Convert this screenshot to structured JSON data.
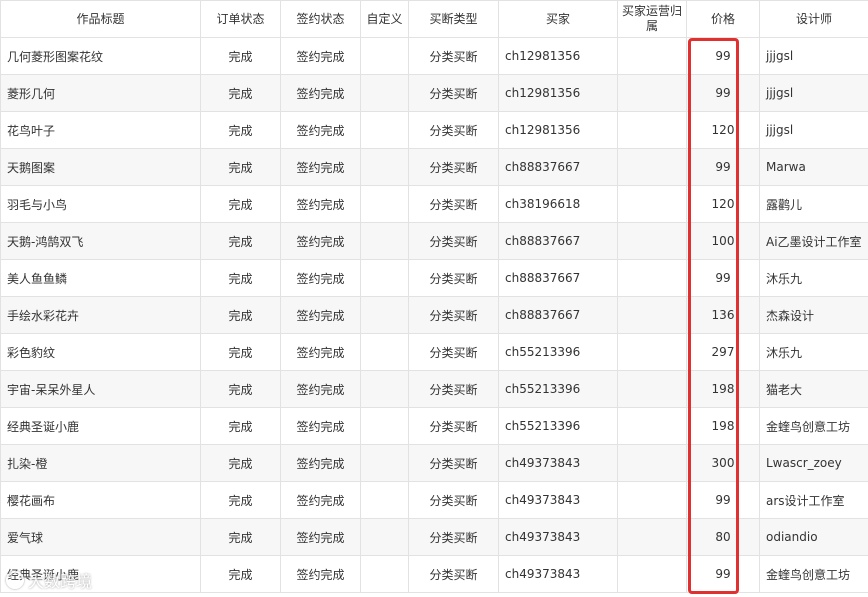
{
  "table": {
    "headers": [
      "作品标题",
      "订单状态",
      "签约状态",
      "自定义",
      "买断类型",
      "买家",
      "买家运营归属",
      "价格",
      "设计师"
    ],
    "rows": [
      [
        "几何菱形图案花纹",
        "完成",
        "签约完成",
        "",
        "分类买断",
        "ch12981356",
        "",
        "99",
        "jjjgsl"
      ],
      [
        "菱形几何",
        "完成",
        "签约完成",
        "",
        "分类买断",
        "ch12981356",
        "",
        "99",
        "jjjgsl"
      ],
      [
        "花鸟叶子",
        "完成",
        "签约完成",
        "",
        "分类买断",
        "ch12981356",
        "",
        "120",
        "jjjgsl"
      ],
      [
        "天鹅图案",
        "完成",
        "签约完成",
        "",
        "分类买断",
        "ch88837667",
        "",
        "99",
        "Marwa"
      ],
      [
        "羽毛与小鸟",
        "完成",
        "签约完成",
        "",
        "分类买断",
        "ch38196618",
        "",
        "120",
        "露鹳儿"
      ],
      [
        "天鹅-鸿鹄双飞",
        "完成",
        "签约完成",
        "",
        "分类买断",
        "ch88837667",
        "",
        "100",
        "Ai乙墨设计工作室"
      ],
      [
        "美人鱼鱼鳞",
        "完成",
        "签约完成",
        "",
        "分类买断",
        "ch88837667",
        "",
        "99",
        "沐乐九"
      ],
      [
        "手绘水彩花卉",
        "完成",
        "签约完成",
        "",
        "分类买断",
        "ch88837667",
        "",
        "136",
        "杰森设计"
      ],
      [
        "彩色豹纹",
        "完成",
        "签约完成",
        "",
        "分类买断",
        "ch55213396",
        "",
        "297",
        "沐乐九"
      ],
      [
        "宇宙-呆呆外星人",
        "完成",
        "签约完成",
        "",
        "分类买断",
        "ch55213396",
        "",
        "198",
        "猫老大"
      ],
      [
        "经典圣诞小鹿",
        "完成",
        "签约完成",
        "",
        "分类买断",
        "ch55213396",
        "",
        "198",
        "金蝰鸟创意工坊"
      ],
      [
        "扎染-橙",
        "完成",
        "签约完成",
        "",
        "分类买断",
        "ch49373843",
        "",
        "300",
        "Lwascr_zoey"
      ],
      [
        "樱花画布",
        "完成",
        "签约完成",
        "",
        "分类买断",
        "ch49373843",
        "",
        "99",
        "ars设计工作室"
      ],
      [
        "爱气球",
        "完成",
        "签约完成",
        "",
        "分类买断",
        "ch49373843",
        "",
        "80",
        "odiandio"
      ],
      [
        "经典圣诞小鹿",
        "完成",
        "签约完成",
        "",
        "分类买断",
        "ch49373843",
        "",
        "99",
        "金蝰鸟创意工坊"
      ]
    ]
  },
  "watermark": {
    "text": "大数跨境"
  },
  "colors": {
    "highlight": "#e03030",
    "row_alt": "#f7f7f7",
    "border": "#e2e2e2"
  }
}
